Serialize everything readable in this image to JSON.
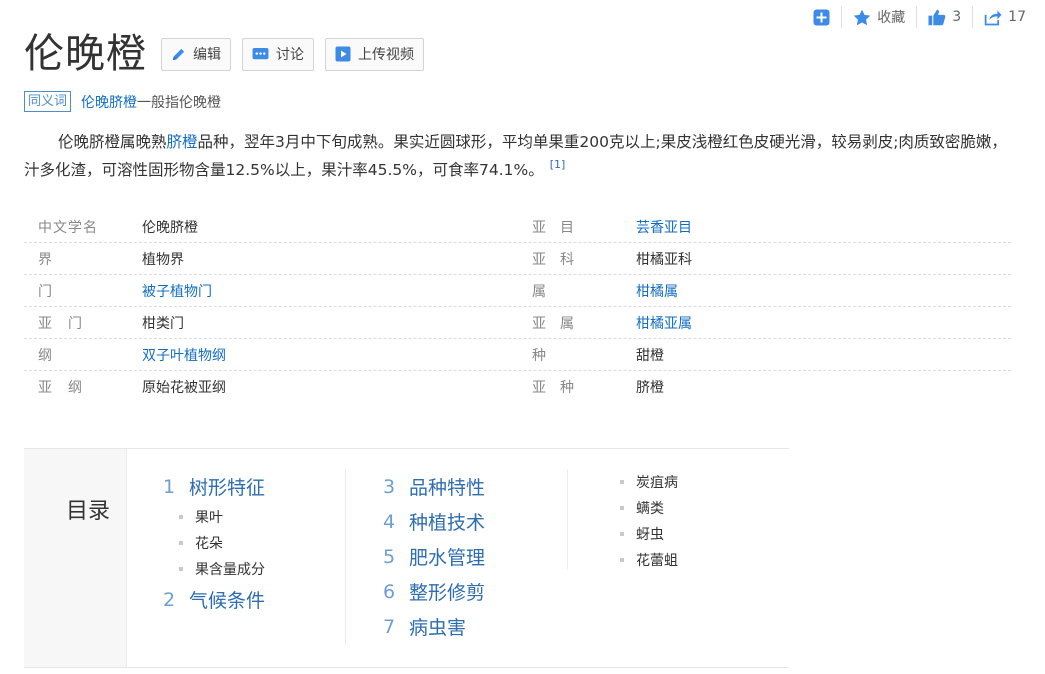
{
  "actions": {
    "collect_label": "收藏",
    "like_count": "3",
    "share_count": "17"
  },
  "title": "伦晚橙",
  "buttons": {
    "edit": "编辑",
    "discuss": "讨论",
    "upload_video": "上传视频"
  },
  "synonym": {
    "tag": "同义词",
    "link": "伦晚脐橙",
    "rest": "一般指伦晚橙"
  },
  "summary": {
    "part1": "伦晚脐橙属晚熟",
    "link": "脐橙",
    "part2": "品种，翌年3月中下旬成熟。果实近圆球形，平均单果重200克以上;果皮浅橙红色皮硬光滑，较易剥皮;肉质致密脆嫩，汁多化渣，可溶性固形物含量12.5%以上，果汁率45.5%，可食率74.1%。",
    "ref": "[1]"
  },
  "info": [
    {
      "k1": "中文学名",
      "v1": "伦晚脐橙",
      "k2": "亚　目",
      "v2": "芸香亚目"
    },
    {
      "k1": "界",
      "v1": "植物界",
      "k2": "亚　科",
      "v2": "柑橘亚科"
    },
    {
      "k1": "门",
      "v1": "被子植物门",
      "k2": "属",
      "v2": "柑橘属"
    },
    {
      "k1": "亚　门",
      "v1": "柑类门",
      "k2": "亚　属",
      "v2": "柑橘亚属"
    },
    {
      "k1": "纲",
      "v1": "双子叶植物纲",
      "k2": "种",
      "v2": "甜橙"
    },
    {
      "k1": "亚　纲",
      "v1": "原始花被亚纲",
      "k2": "亚　种",
      "v2": "脐橙"
    }
  ],
  "catalog": {
    "title": "目录",
    "sections": [
      {
        "num": "1",
        "label": "树形特征",
        "subs": [
          "果叶",
          "花朵",
          "果含量成分"
        ]
      },
      {
        "num": "2",
        "label": "气候条件"
      },
      {
        "num": "3",
        "label": "品种特性"
      },
      {
        "num": "4",
        "label": "种植技术"
      },
      {
        "num": "5",
        "label": "肥水管理"
      },
      {
        "num": "6",
        "label": "整形修剪"
      },
      {
        "num": "7",
        "label": "病虫害",
        "subs": [
          "炭疽病",
          "螨类",
          "蚜虫",
          "花蕾蛆"
        ]
      }
    ]
  },
  "colors": {
    "link": "#136ec2",
    "catalog_number": "#6d9fd2",
    "catalog_label": "#2e6db0",
    "icon_blue": "#3d8be6"
  },
  "icons": [
    "plus-square-icon",
    "star-icon",
    "thumbs-up-icon",
    "share-icon",
    "pencil-icon",
    "chat-icon",
    "play-icon"
  ]
}
